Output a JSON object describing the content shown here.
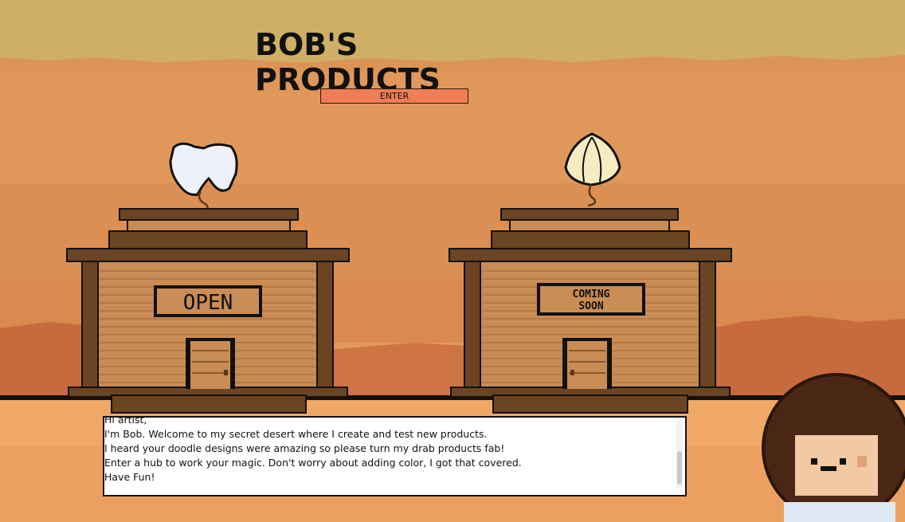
{
  "page": {
    "title": "BOB'S PRODUCTS",
    "enter_label": "ENTER"
  },
  "buildings": [
    {
      "sign": "OPEN",
      "roof_icon": "tooth-flower-icon",
      "status": "open"
    },
    {
      "sign_line1": "COMING",
      "sign_line2": "SOON",
      "roof_icon": "bulb-flower-icon",
      "status": "coming-soon"
    }
  ],
  "dialog": {
    "lines": [
      "Hi artist,",
      "I'm Bob. Welcome to my secret desert where I create and test new products.",
      "I heard your doodle designs were amazing so please turn my drab products fab!",
      "Enter a hub to work your magic. Don't worry about adding color, I got that covered.",
      "Have Fun!"
    ]
  },
  "character": {
    "name": "bob-avatar"
  },
  "colors": {
    "sky": "#cfae66",
    "desert": "#e19a5b",
    "wood": "#c98c55",
    "wood_dark": "#5a3a1e",
    "button": "#f07e54"
  }
}
